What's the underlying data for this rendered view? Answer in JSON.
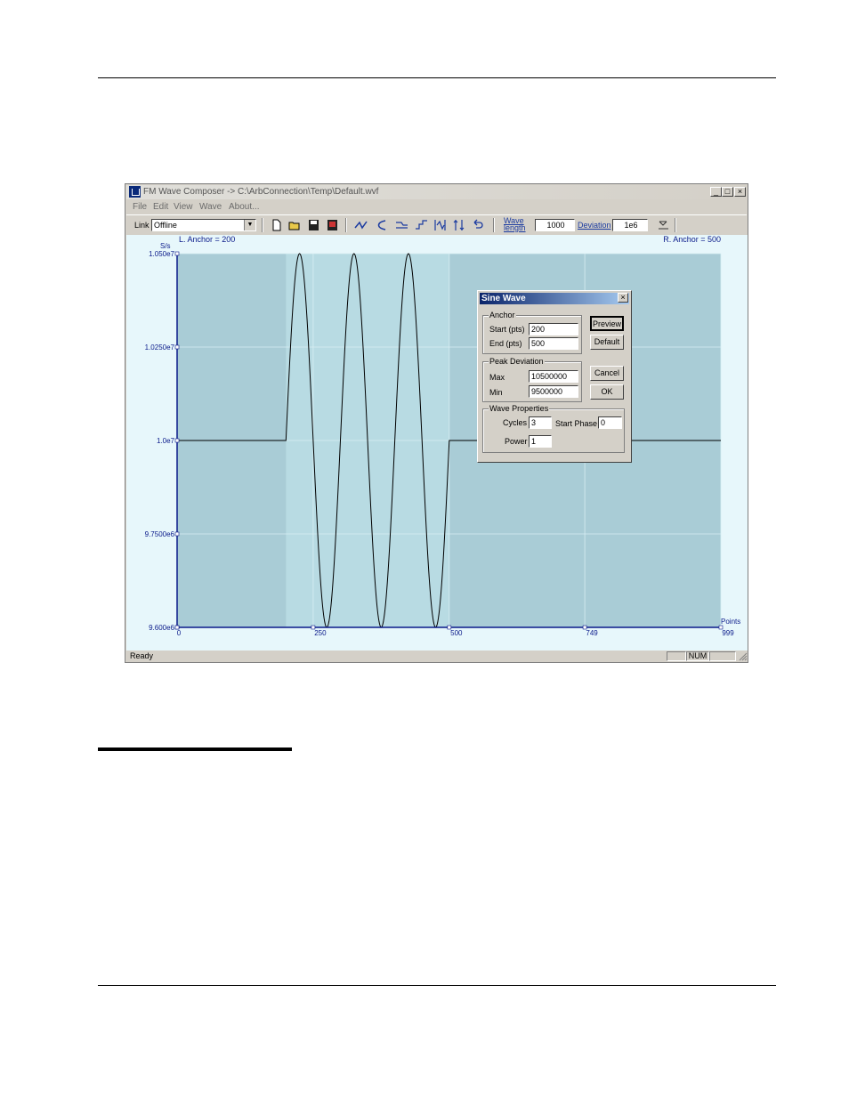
{
  "window": {
    "title": "FM Wave Composer -> C:\\ArbConnection\\Temp\\Default.wvf",
    "controls": {
      "minimize": "_",
      "maximize": "□",
      "close": "×"
    }
  },
  "menu": [
    "File",
    "Edit",
    "View",
    "Wave",
    "About..."
  ],
  "toolbar": {
    "link_label": "Link",
    "link_value": "Offline",
    "wave_length_label": "Wave length",
    "wave_length_value": "1000",
    "deviation_label": "Deviation",
    "deviation_value": "1e6",
    "icons": [
      "new-file-icon",
      "open-folder-icon",
      "save-icon",
      "download-icon",
      "draw-wave-icon",
      "smooth-icon",
      "filter-icon",
      "step-icon",
      "expand-icon",
      "compress-icon",
      "undo-icon",
      "link-instrument-icon"
    ]
  },
  "plot": {
    "left_anchor_label": "L. Anchor = 200",
    "right_anchor_label": "R. Anchor = 500",
    "y_unit": "S/s",
    "x_unit": "Points",
    "y_tick_labels": [
      "1.050e7",
      "1.0250e7",
      "1.0e7",
      "9.7500e6",
      "9.600e6"
    ],
    "x_tick_labels": [
      "0",
      "250",
      "500",
      "749",
      "999"
    ],
    "colors": {
      "plot_bg": "#a9ccd6",
      "anchor_region": "#b8dbe3",
      "frame": "#e7f7fb",
      "trace": "#000000",
      "axis": "#0a1a8a"
    }
  },
  "chart_data": {
    "type": "line",
    "x_range": [
      0,
      999
    ],
    "y_range": [
      9500000,
      10500000
    ],
    "baseline": 10000000,
    "anchor_start": 200,
    "anchor_end": 500,
    "cycles": 3,
    "max": 10500000,
    "min": 9500000,
    "start_phase": 0,
    "xlabel": "Points",
    "ylabel": "S/s",
    "grid": true
  },
  "dialog": {
    "title": "Sine Wave",
    "anchor_group": "Anchor",
    "start_label": "Start (pts)",
    "start_value": "200",
    "end_label": "End (pts)",
    "end_value": "500",
    "peak_group": "Peak Deviation",
    "max_label": "Max",
    "max_value": "10500000",
    "min_label": "Min",
    "min_value": "9500000",
    "props_group": "Wave Properties",
    "cycles_label": "Cycles",
    "cycles_value": "3",
    "phase_label": "Start Phase",
    "phase_value": "0",
    "power_label": "Power",
    "power_value": "1",
    "buttons": {
      "preview": "Preview",
      "default": "Default",
      "cancel": "Cancel",
      "ok": "OK"
    }
  },
  "status": {
    "text": "Ready",
    "num": "NUM"
  }
}
